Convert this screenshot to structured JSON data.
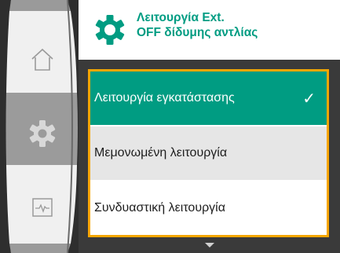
{
  "header": {
    "icon": "gear-icon",
    "title_line1": "Λειτουργία Ext.",
    "title_line2": "OFF δίδυμης αντλίας"
  },
  "rail": {
    "items": [
      {
        "icon": "home-icon",
        "active": false
      },
      {
        "icon": "gear-icon",
        "active": true
      },
      {
        "icon": "monitor-pulse-icon",
        "active": false
      }
    ]
  },
  "options": [
    {
      "label": "Λειτουργία εγκατάστασης",
      "selected": true,
      "checked": true
    },
    {
      "label": "Μεμονωμένη λειτουργία",
      "selected": false,
      "checked": false
    },
    {
      "label": "Συνδυαστική λειτουργία",
      "selected": false,
      "checked": false
    }
  ],
  "colors": {
    "accent": "#009c82",
    "focus_border": "#f7a600",
    "dark_bg": "#3a3a3a"
  },
  "scroll_indicator": "chevron-down-icon"
}
